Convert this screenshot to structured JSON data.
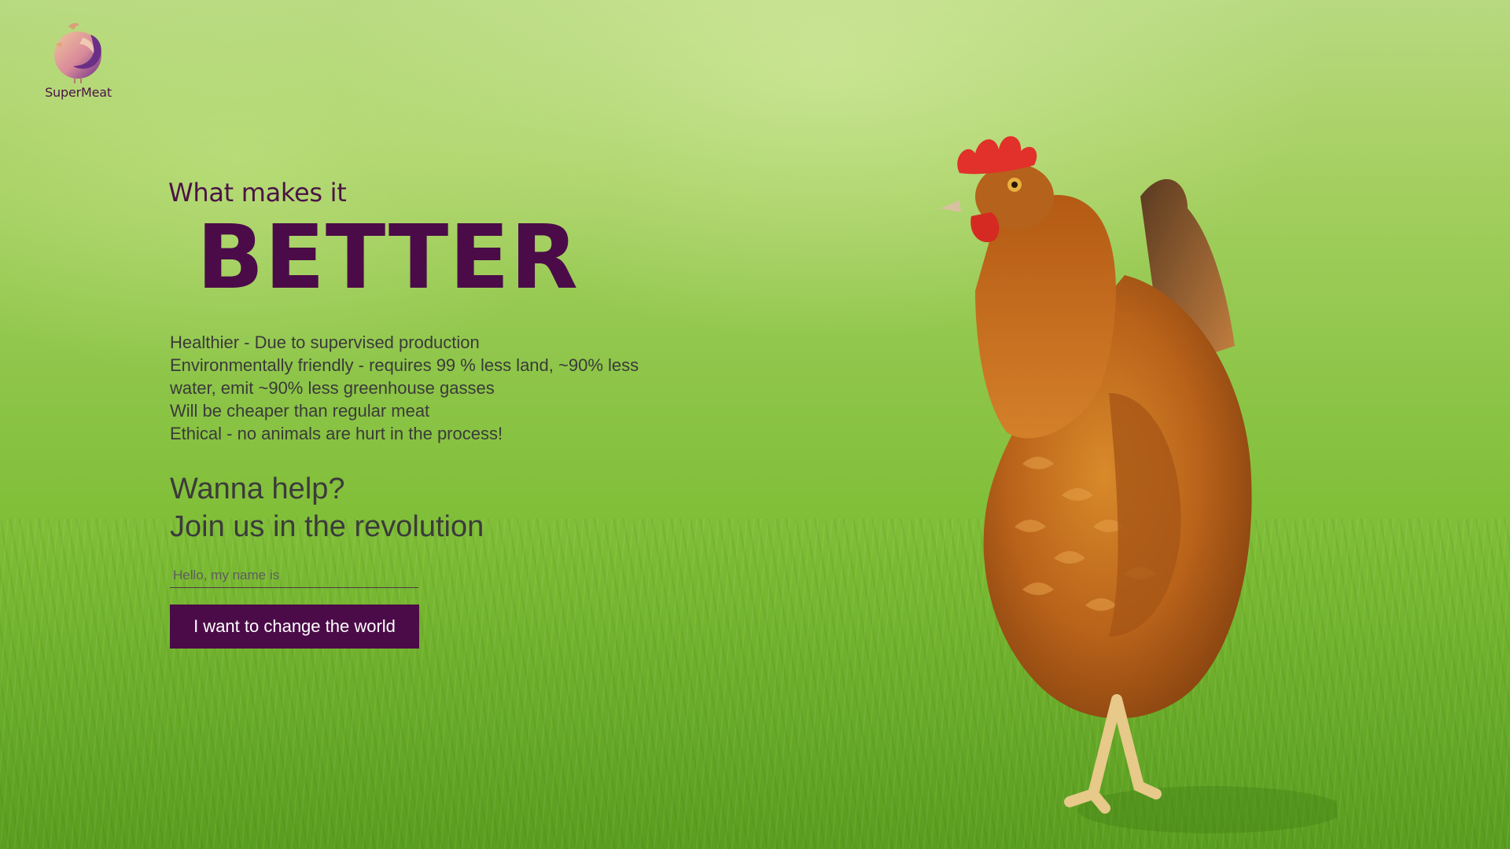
{
  "brand": {
    "name": "SuperMeat",
    "logo_icon": "chicken-logo-icon",
    "color_primary": "#4b0b48",
    "color_logo_gradient": [
      "#e8b08a",
      "#7a3a8a"
    ]
  },
  "hero": {
    "eyebrow": "What makes it",
    "headline": "BETTER"
  },
  "benefits": [
    "Healthier - Due to supervised production",
    "Environmentally friendly - requires 99 % less land, ~90% less water, emit ~90% less greenhouse gasses",
    "Will be cheaper than regular meat",
    "Ethical - no animals are hurt in the process!"
  ],
  "cta": {
    "line1": "Wanna help?",
    "line2": "Join us in the revolution",
    "name_placeholder": "Hello, my name is",
    "name_value": "",
    "button_label": "I want to change the world"
  },
  "background": {
    "subject": "chicken-photo",
    "grass_color": "#7dbd34"
  }
}
